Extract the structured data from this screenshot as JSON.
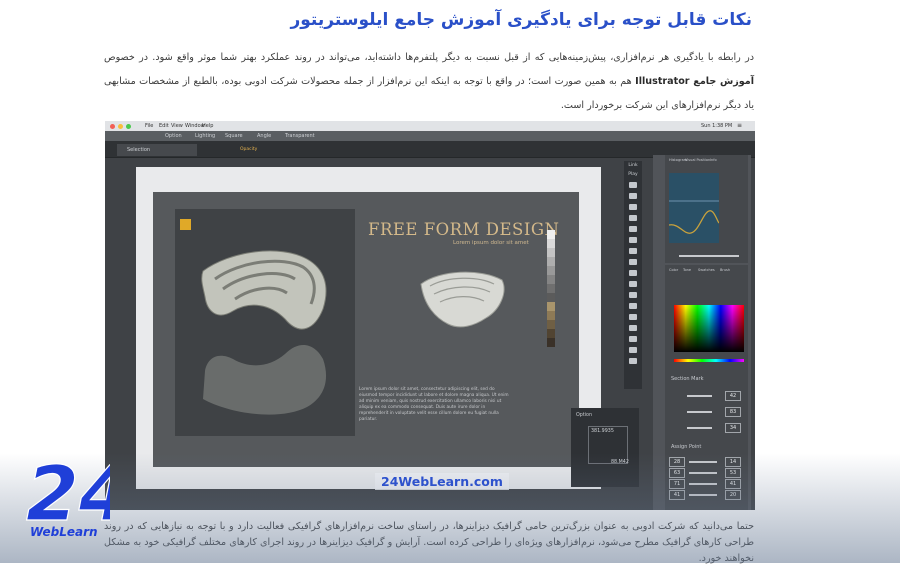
{
  "article": {
    "heading": "نکات قابل توجه برای یادگیری آموزش جامع ایلوستریتور",
    "para1_part1": "در رابطه با یادگیری هر نرم‌افزاری، پیش‌زمینه‌هایی که از قبل نسبت به دیگر پلتفرم‌ها داشته‌اید، می‌تواند در روند عملکرد بهتر شما موثر واقع شود. در خصوص",
    "para1_bold": "آموزش جامع Illustrator",
    "para1_part2": "هم به همین صورت است؛ در واقع با توجه به اینکه این نرم‌افزار از جمله محصولات شرکت ادوبی بوده، بالطبع از مشخصات مشابهی یاد دیگر نرم‌افزارهای این شرکت برخوردار است.",
    "para2": "حتما می‌دانید که شرکت ادوبی به عنوان بزرگ‌ترین حامی گرافیک دیزاینرها، در راستای ساخت نرم‌افزارهای گرافیکی فعالیت دارد و با توجه به نیازهایی که در روند طراحی کارهای گرافیک مطرح می‌شود، نرم‌افزارهای ویژه‌ای را طراحی کرده است. آرایش و گرافیک دیزاینرها در روند اجرای کارهای مختلف گرافیکی خود به مشکل نخواهند خورد."
  },
  "screenshot": {
    "menu": [
      "File",
      "Edit",
      "View",
      "Window",
      "Help"
    ],
    "clock": "Sun 1:38 PM",
    "options": [
      "Selection",
      "Option",
      "Lighting",
      "Square",
      "Angle",
      "Transparent"
    ],
    "opacity_label": "Opacity",
    "artboard": {
      "title": "FREE FORM DESIGN",
      "subtitle": "Lorem ipsum dolor sit amet",
      "body": "Lorem ipsum dolor sit amet, consectetur adipiscing elit, sed do eiusmod tempor incididunt ut labore et dolore magna aliqua. Ut enim ad minim veniam, quis nostrud exercitation ullamco laboris nisi ut aliquip ex ea commodo consequat. Duis aute irure dolor in reprehenderit in voluptate velit esse cillum dolore eu fugiat nulla pariatur."
    },
    "tools_labels": [
      "Link",
      "Play"
    ],
    "histogram_tabs": [
      "Histogram",
      "Visual Position",
      "Info"
    ],
    "color_tabs": [
      "Color",
      "Tone",
      "Swatches",
      "Brush"
    ],
    "section_mark": {
      "label": "Section Mark",
      "values": [
        "42",
        "83",
        "34"
      ]
    },
    "assign_point": {
      "label": "Assign Point",
      "left": [
        "28",
        "63",
        "71",
        "41"
      ],
      "right": [
        "14",
        "53",
        "41",
        "20"
      ]
    },
    "navigator": {
      "label": "Option",
      "values": [
        "381.9935",
        "88.M42"
      ]
    },
    "watermark": "24WebLearn.com"
  },
  "logo": {
    "number": "24",
    "text": "WebLearn"
  },
  "colors": {
    "heading": "#2a50c8",
    "brand": "#1f3fd8",
    "accent_yellow": "#e0a928",
    "artboard_title": "#d4b98a"
  }
}
